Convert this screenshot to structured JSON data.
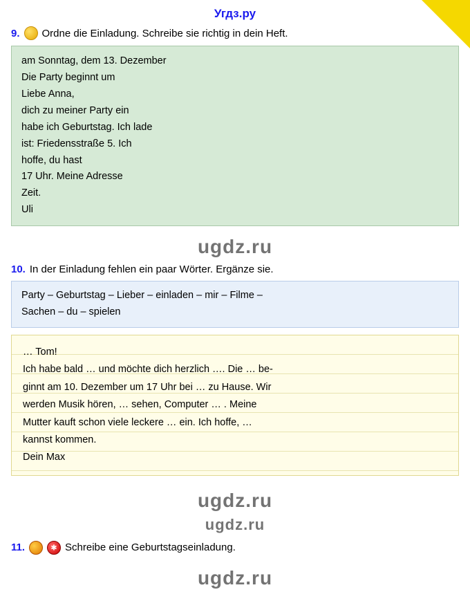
{
  "header": {
    "title": "Угдз.ру"
  },
  "section9": {
    "number": "9.",
    "instruction": "Ordne die Einladung. Schreibe sie richtig in dein Heft.",
    "content_lines": [
      "am Sonntag, dem 13. Dezember",
      "Die Party beginnt um",
      "Liebe Anna,",
      "dich zu meiner Party ein",
      "habe ich Geburtstag.       Ich lade",
      "ist: Friedensstraße 5.    Ich",
      "hoffe, du hast",
      "17 Uhr.            Meine Adresse",
      "Zeit.",
      "Uli"
    ]
  },
  "watermark1": "ugdz.ru",
  "section10": {
    "number": "10.",
    "instruction": "In der Einladung fehlen ein paar Wörter. Ergänze sie.",
    "words_line1": "Party – Geburtstag – Lieber – einladen – mir – Filme –",
    "words_line2": "Sachen – du – spielen",
    "letter_lines": [
      "… Tom!",
      "Ich habe bald … und möchte dich herzlich …. Die … be-",
      "ginnt am 10. Dezember um 17 Uhr bei … zu Hause. Wir",
      "werden Musik hören, … sehen, Computer … . Meine",
      "Mutter kauft schon viele leckere … ein. Ich hoffe, …",
      "kannst kommen.",
      "Dein Max"
    ]
  },
  "watermark2": "ugdz.ru",
  "watermark3": "ugdz.ru",
  "section11": {
    "number": "11.",
    "instruction": "Schreibe eine Geburtstagseinladung."
  },
  "watermark4": "ugdz.ru"
}
